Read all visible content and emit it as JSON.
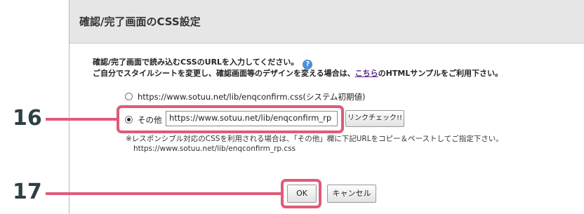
{
  "dialog": {
    "title": "確認/完了画面のCSS設定",
    "description_line1": "確認/完了画面で読み込むCSSのURLを入力してください。",
    "help_icon": "?",
    "description_line2_before": "ご自分でスタイルシートを変更し、確認画面等のデザインを変える場合は、",
    "description_link": "こちら",
    "description_line2_after": "のHTMLサンプルをご利用下さい。"
  },
  "options": {
    "default_label": "https://www.sotuu.net/lib/enqconfirm.css(システム初期値)",
    "default_checked": false,
    "other_label": "その他",
    "other_checked": true,
    "other_url_value": "https://www.sotuu.net/lib/enqconfirm_rp",
    "link_check_label": "リンクチェック!!"
  },
  "note": {
    "line1": "※レスポンシブル対応のCSSを利用される場合は、「その他」欄に下記URLをコピー＆ペーストしてご指定下さい。",
    "line2": "https://www.sotuu.net/lib/enqconfirm_rp.css"
  },
  "buttons": {
    "ok_label": "OK",
    "cancel_label": "キャンセル"
  },
  "callouts": {
    "label16": "16",
    "label17": "17",
    "color": "#e05a7a"
  }
}
